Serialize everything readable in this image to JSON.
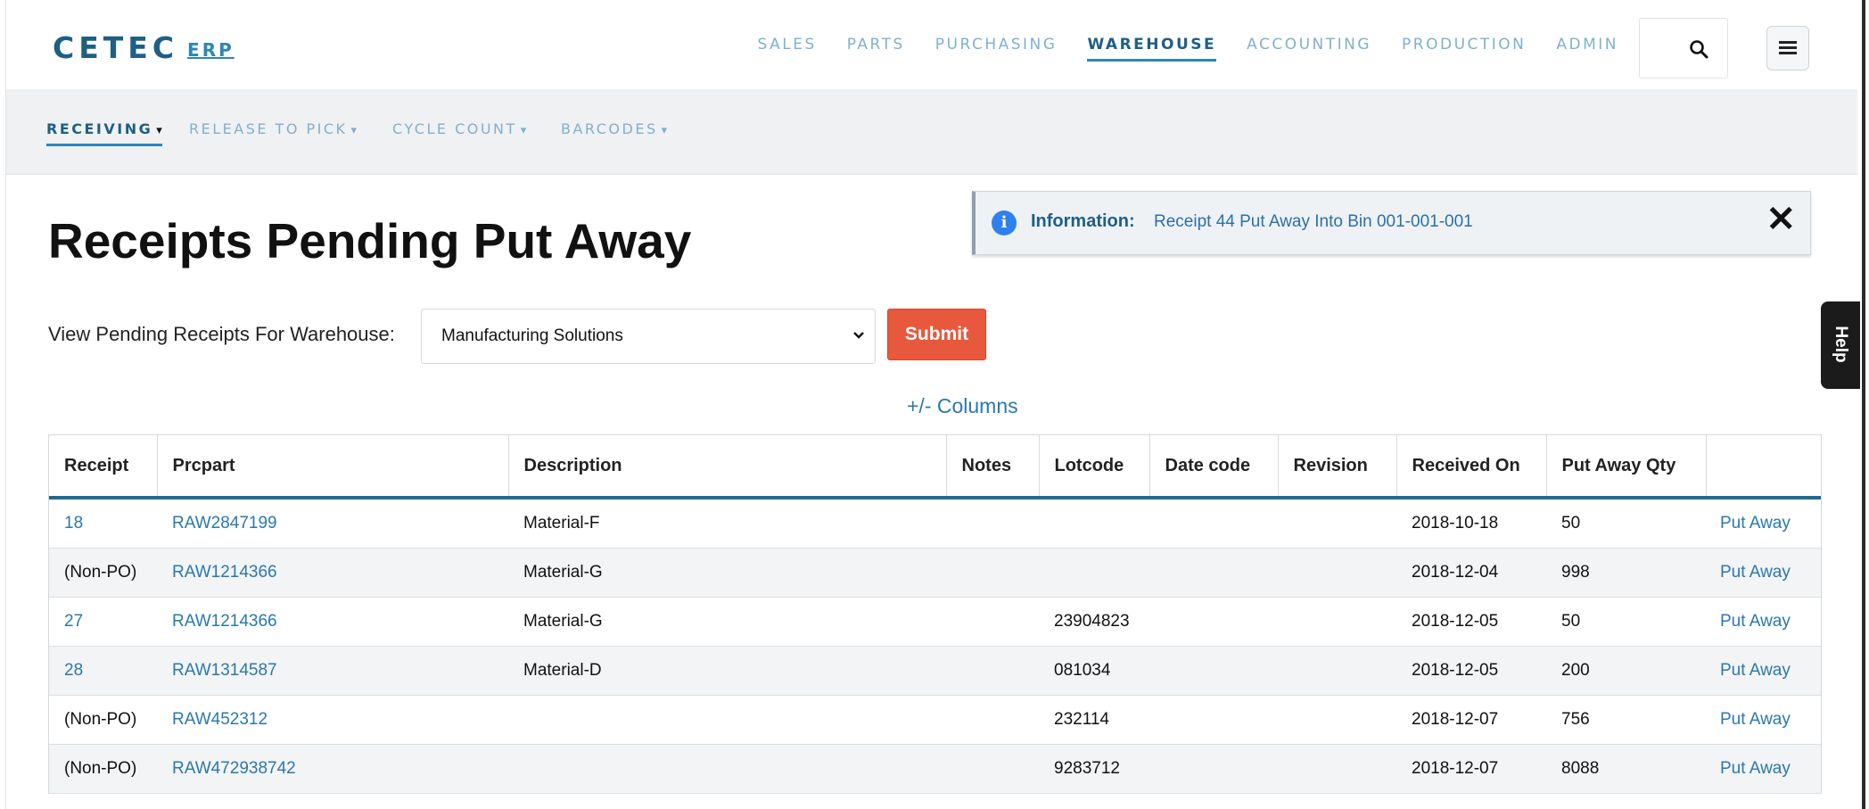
{
  "brand": {
    "name": "CETEC",
    "suffix": "ERP"
  },
  "topnav": {
    "items": [
      {
        "label": "SALES"
      },
      {
        "label": "PARTS"
      },
      {
        "label": "PURCHASING"
      },
      {
        "label": "WAREHOUSE",
        "active": true
      },
      {
        "label": "ACCOUNTING"
      },
      {
        "label": "PRODUCTION"
      },
      {
        "label": "ADMIN"
      }
    ]
  },
  "subnav": {
    "items": [
      {
        "label": "RECEIVING",
        "active": true
      },
      {
        "label": "RELEASE TO PICK"
      },
      {
        "label": "CYCLE COUNT"
      },
      {
        "label": "BARCODES"
      }
    ],
    "caret": "▾"
  },
  "page": {
    "title": "Receipts Pending Put Away"
  },
  "alert": {
    "label": "Information:",
    "message": "Receipt 44 Put Away Into Bin 001-001-001",
    "close": "✕"
  },
  "filter": {
    "label": "View Pending Receipts For Warehouse:",
    "selected": "Manufacturing Solutions",
    "submit_label": "Submit"
  },
  "columns_toggle": "+/- Columns",
  "table": {
    "headers": [
      "Receipt",
      "Prcpart",
      "Description",
      "Notes",
      "Lotcode",
      "Date code",
      "Revision",
      "Received On",
      "Put Away Qty",
      ""
    ],
    "action_label": "Put Away",
    "rows": [
      {
        "receipt": "18",
        "receipt_link": true,
        "prcpart": "RAW2847199",
        "description": "Material-F",
        "notes": "",
        "lotcode": "",
        "datecode": "",
        "revision": "",
        "received_on": "2018-10-18",
        "qty": "50"
      },
      {
        "receipt": "(Non-PO)",
        "receipt_link": false,
        "prcpart": "RAW1214366",
        "description": "Material-G",
        "notes": "",
        "lotcode": "",
        "datecode": "",
        "revision": "",
        "received_on": "2018-12-04",
        "qty": "998"
      },
      {
        "receipt": "27",
        "receipt_link": true,
        "prcpart": "RAW1214366",
        "description": "Material-G",
        "notes": "",
        "lotcode": "23904823",
        "datecode": "",
        "revision": "",
        "received_on": "2018-12-05",
        "qty": "50"
      },
      {
        "receipt": "28",
        "receipt_link": true,
        "prcpart": "RAW1314587",
        "description": "Material-D",
        "notes": "",
        "lotcode": "081034",
        "datecode": "",
        "revision": "",
        "received_on": "2018-12-05",
        "qty": "200"
      },
      {
        "receipt": "(Non-PO)",
        "receipt_link": false,
        "prcpart": "RAW452312",
        "description": "",
        "notes": "",
        "lotcode": "232114",
        "datecode": "",
        "revision": "",
        "received_on": "2018-12-07",
        "qty": "756"
      },
      {
        "receipt": "(Non-PO)",
        "receipt_link": false,
        "prcpart": "RAW472938742",
        "description": "",
        "notes": "",
        "lotcode": "9283712",
        "datecode": "",
        "revision": "",
        "received_on": "2018-12-07",
        "qty": "8088"
      }
    ]
  },
  "help_tab": "Help",
  "icons": {
    "search": "search-icon",
    "menu": "hamburger-menu-icon",
    "info": "info-icon",
    "close": "close-icon",
    "chevron": "chevron-down-icon"
  },
  "colors": {
    "brand": "#1f5f84",
    "link": "#2a78ad",
    "submit": "#e8583d",
    "info": "#2f80ed"
  }
}
